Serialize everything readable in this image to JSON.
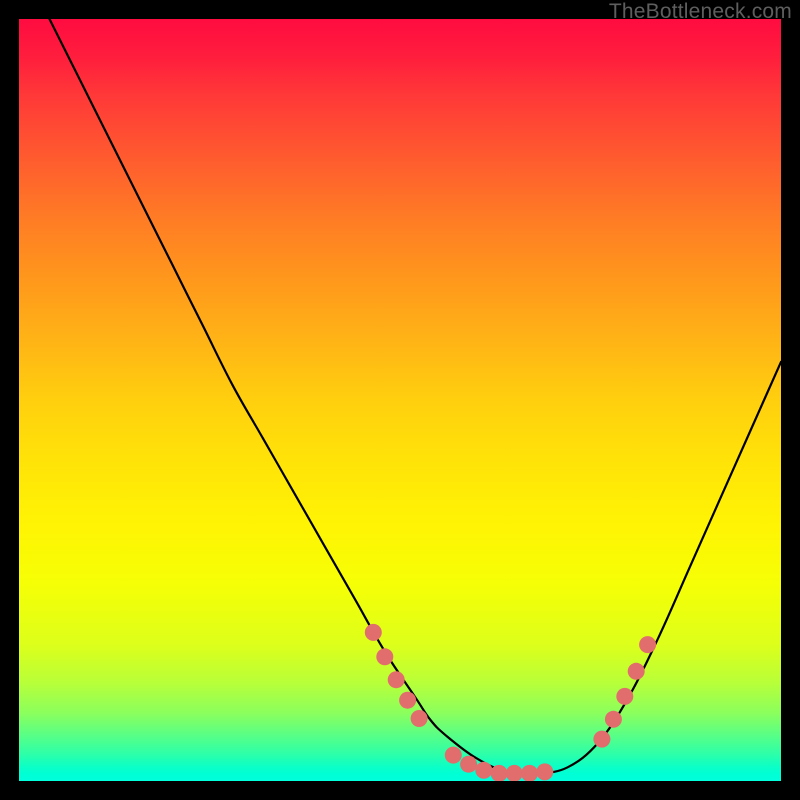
{
  "watermark": "TheBottleneck.com",
  "chart_data": {
    "type": "line",
    "title": "",
    "xlabel": "",
    "ylabel": "",
    "xlim": [
      0,
      100
    ],
    "ylim": [
      0,
      100
    ],
    "grid": false,
    "series": [
      {
        "name": "bottleneck-curve",
        "x_pct": [
          4,
          8,
          12,
          16,
          20,
          24,
          28,
          32,
          36,
          40,
          44,
          48,
          52,
          54,
          56,
          60,
          64,
          68,
          72,
          76,
          80,
          84,
          88,
          92,
          96,
          100
        ],
        "y_pct": [
          100,
          92,
          84,
          76,
          68,
          60,
          52,
          45,
          38,
          31,
          24,
          17,
          11,
          8,
          6,
          3,
          1.2,
          1.0,
          1.8,
          5,
          11,
          19,
          28,
          37,
          46,
          55
        ]
      }
    ],
    "markers": {
      "name": "highlight-dots",
      "color": "#e26d6d",
      "x_pct": [
        46.5,
        48.0,
        49.5,
        51.0,
        52.5,
        57.0,
        59.0,
        61.0,
        63.0,
        65.0,
        67.0,
        69.0,
        76.5,
        78.0,
        79.5,
        81.0,
        82.5
      ],
      "y_pct": [
        19.5,
        16.3,
        13.3,
        10.6,
        8.2,
        3.4,
        2.2,
        1.4,
        1.0,
        1.0,
        1.0,
        1.2,
        5.5,
        8.1,
        11.1,
        14.4,
        17.9
      ]
    },
    "background": {
      "type": "vertical-gradient",
      "stops": [
        {
          "pos": 0.0,
          "color": "#ff0b40"
        },
        {
          "pos": 0.5,
          "color": "#ffcf0e"
        },
        {
          "pos": 0.82,
          "color": "#ddff1a"
        },
        {
          "pos": 1.0,
          "color": "#00ffdb"
        }
      ]
    }
  }
}
